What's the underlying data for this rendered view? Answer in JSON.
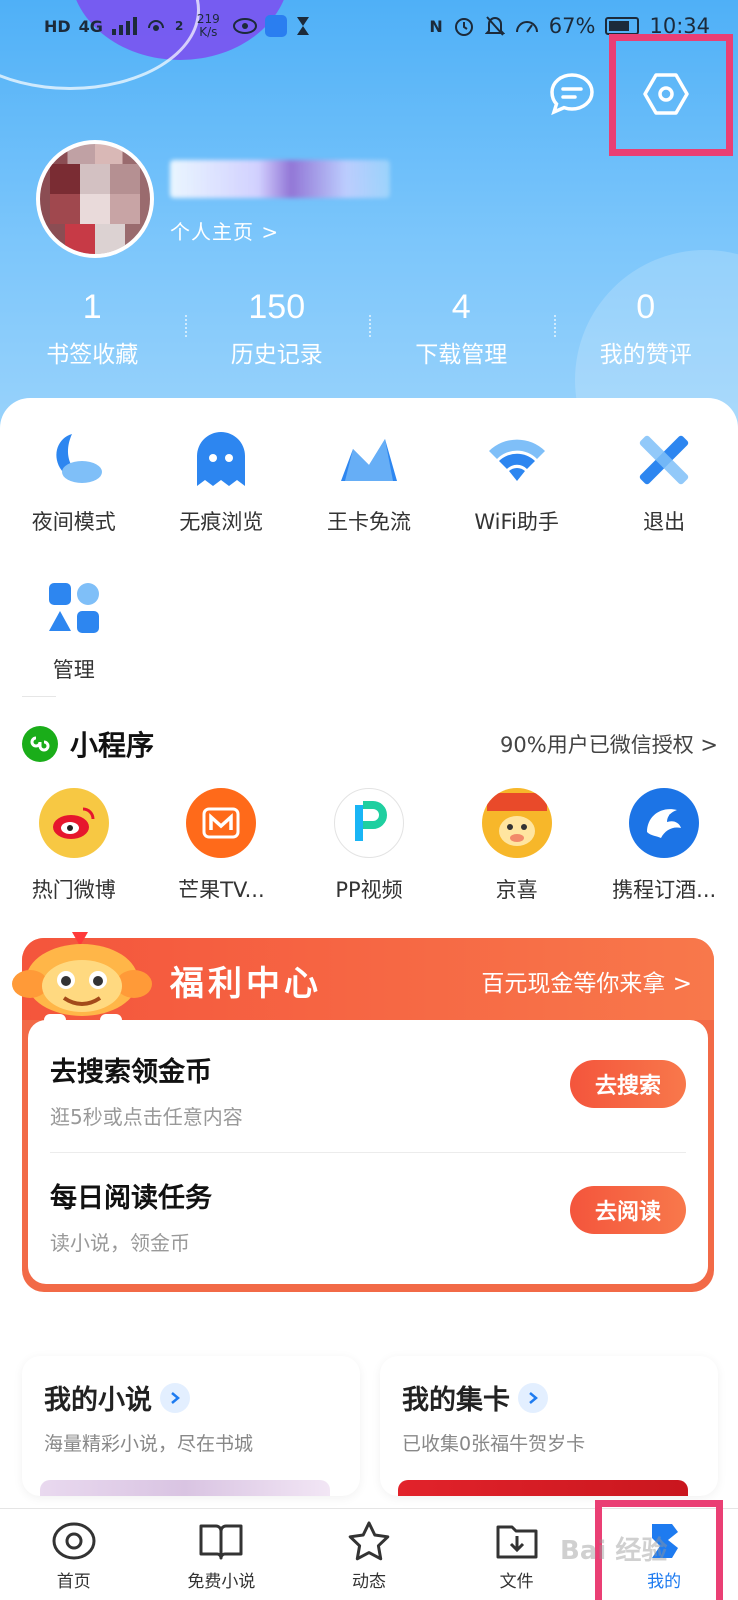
{
  "status_bar": {
    "network_left": "HD",
    "network_gen": "4G",
    "data_speed": "219 K/s",
    "signal_count": "2",
    "battery": "67%",
    "time": "10:34"
  },
  "header": {
    "profile_link": "个人主页 >",
    "stats": [
      {
        "value": "1",
        "label": "书签收藏"
      },
      {
        "value": "150",
        "label": "历史记录"
      },
      {
        "value": "4",
        "label": "下载管理"
      },
      {
        "value": "0",
        "label": "我的赞评"
      }
    ]
  },
  "tools": {
    "row1": [
      {
        "label": "夜间模式",
        "icon": "moon-cloud-icon"
      },
      {
        "label": "无痕浏览",
        "icon": "ghost-icon"
      },
      {
        "label": "王卡免流",
        "icon": "crown-icon"
      },
      {
        "label": "WiFi助手",
        "icon": "wifi-icon"
      },
      {
        "label": "退出",
        "icon": "exit-x-icon"
      }
    ],
    "row2": [
      {
        "label": "管理",
        "icon": "manage-shapes-icon"
      }
    ]
  },
  "mini_programs": {
    "title": "小程序",
    "more": "90%用户已微信授权 >",
    "items": [
      {
        "label": "热门微博",
        "icon": "weibo-icon",
        "color": "#f7c843"
      },
      {
        "label": "芒果TV...",
        "icon": "mango-tv-icon",
        "color": "#ff6a1a"
      },
      {
        "label": "PP视频",
        "icon": "pp-video-icon",
        "color": "#ffffff"
      },
      {
        "label": "京喜",
        "icon": "jingxi-icon",
        "color": "#f7b72a"
      },
      {
        "label": "携程订酒...",
        "icon": "ctrip-dolphin-icon",
        "color": "#1c74e6"
      }
    ]
  },
  "welfare": {
    "title": "福利中心",
    "more": "百元现金等你来拿 >",
    "tasks": [
      {
        "title": "去搜索领金币",
        "sub": "逛5秒或点击任意内容",
        "button": "去搜索"
      },
      {
        "title": "每日阅读任务",
        "sub": "读小说，领金币",
        "button": "去阅读"
      }
    ]
  },
  "cards": [
    {
      "title": "我的小说",
      "sub": "海量精彩小说，尽在书城"
    },
    {
      "title": "我的集卡",
      "sub": "已收集0张福牛贺岁卡"
    }
  ],
  "tabbar": [
    {
      "label": "首页",
      "icon": "eye-icon"
    },
    {
      "label": "免费小说",
      "icon": "book-icon"
    },
    {
      "label": "动态",
      "icon": "star-icon"
    },
    {
      "label": "文件",
      "icon": "folder-download-icon"
    },
    {
      "label": "我的",
      "icon": "me-icon",
      "active": true
    }
  ],
  "watermark": "Bai 经验",
  "colors": {
    "accent_blue": "#1e7bf0",
    "header_blue": "#4fb0f7",
    "welfare_red": "#f4553c",
    "highlight_pink": "#ea3f74"
  }
}
